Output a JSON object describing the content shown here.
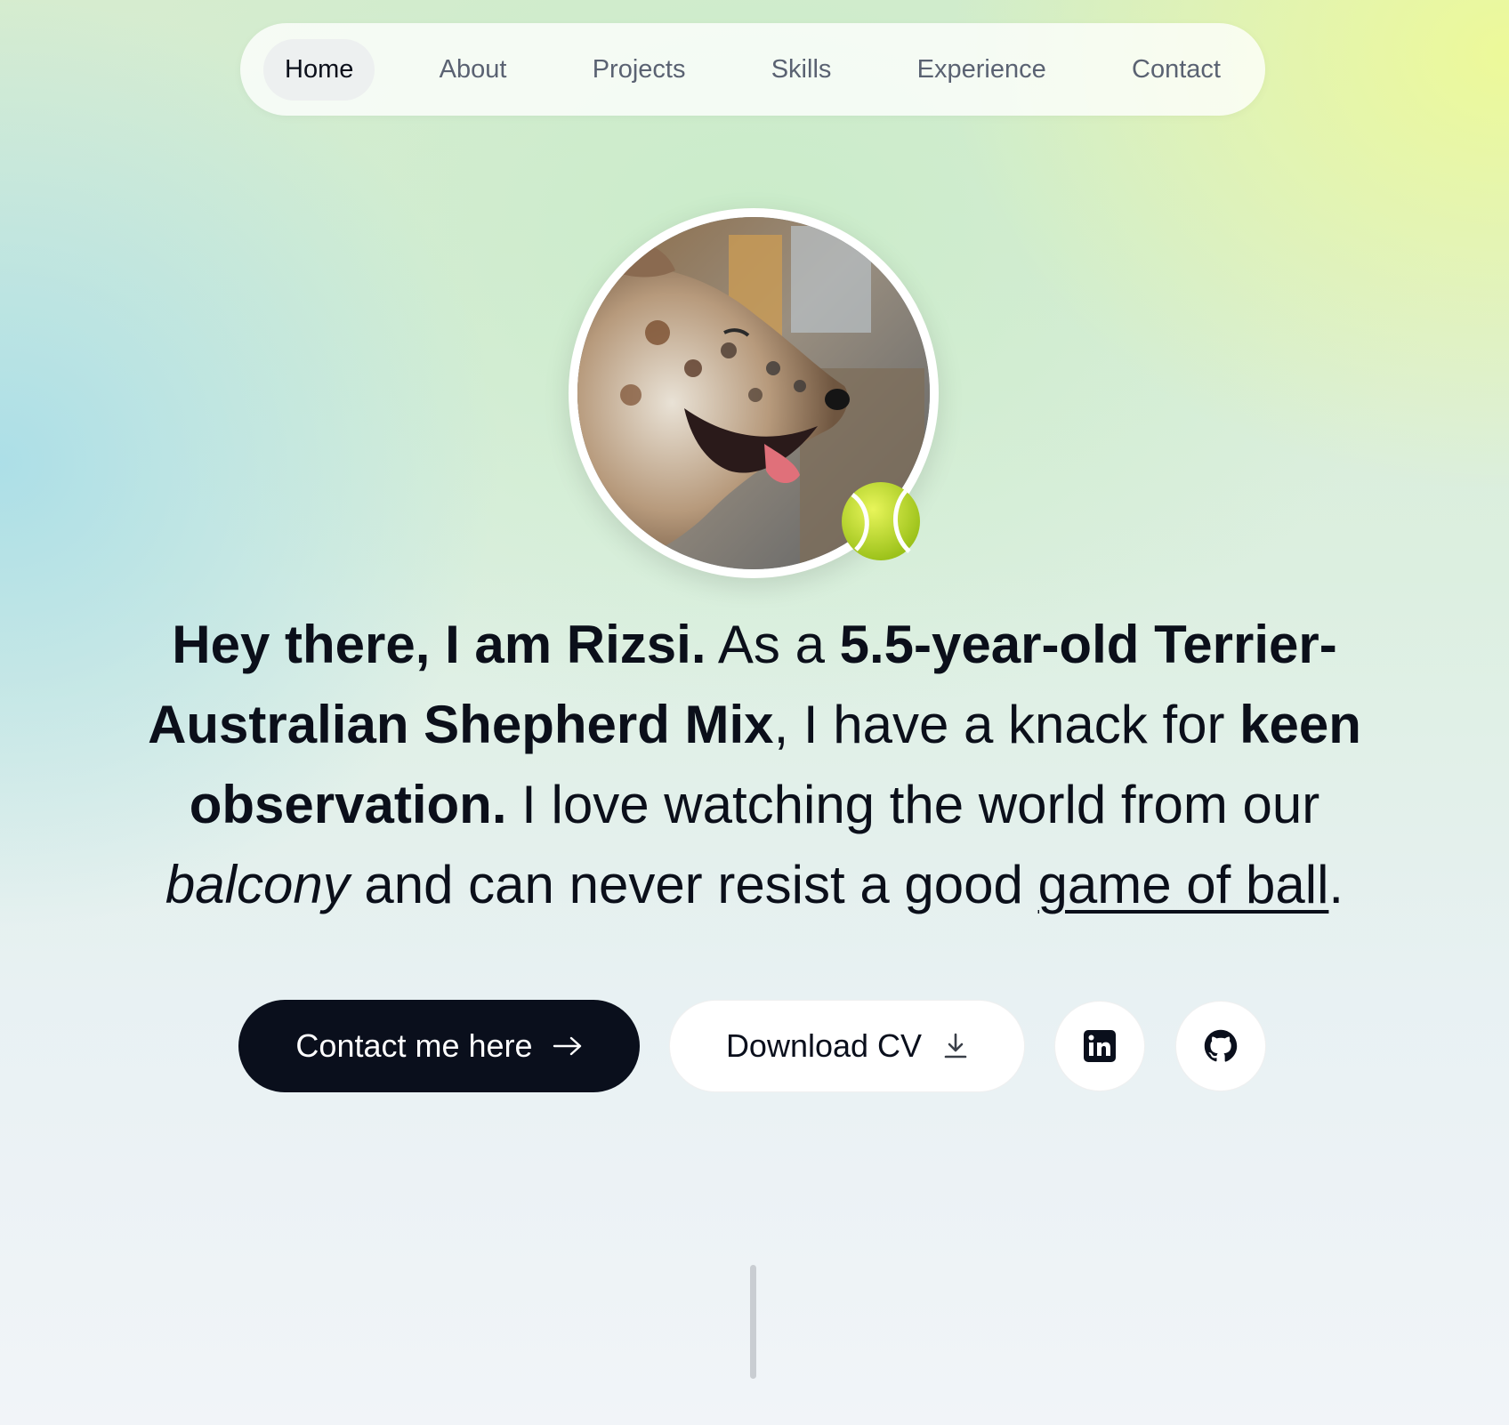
{
  "nav": {
    "items": [
      {
        "label": "Home",
        "active": true
      },
      {
        "label": "About",
        "active": false
      },
      {
        "label": "Projects",
        "active": false
      },
      {
        "label": "Skills",
        "active": false
      },
      {
        "label": "Experience",
        "active": false
      },
      {
        "label": "Contact",
        "active": false
      }
    ]
  },
  "hero": {
    "avatar_icon": "dog-photo",
    "badge_icon": "tennis-ball-icon",
    "headline": {
      "part1_bold": "Hey there, I am Rizsi.",
      "part2": " As a ",
      "part3_bold": "5.5-year-old Terrier-Australian Shepherd Mix",
      "part4": ", I have a knack for ",
      "part5_bold": "keen observation.",
      "part6": " I love watching the world from our ",
      "part7_italic": "balcony",
      "part8": " and can never resist a good ",
      "part9_underline": "game of ball",
      "part10": "."
    }
  },
  "actions": {
    "contact_label": "Contact me here",
    "contact_icon": "arrow-right-icon",
    "download_label": "Download CV",
    "download_icon": "download-icon",
    "linkedin_icon": "linkedin-icon",
    "github_icon": "github-icon"
  },
  "colors": {
    "primary_button": "#0a0f1c",
    "text": "#0b0f1a",
    "nav_text": "#5a6272"
  }
}
